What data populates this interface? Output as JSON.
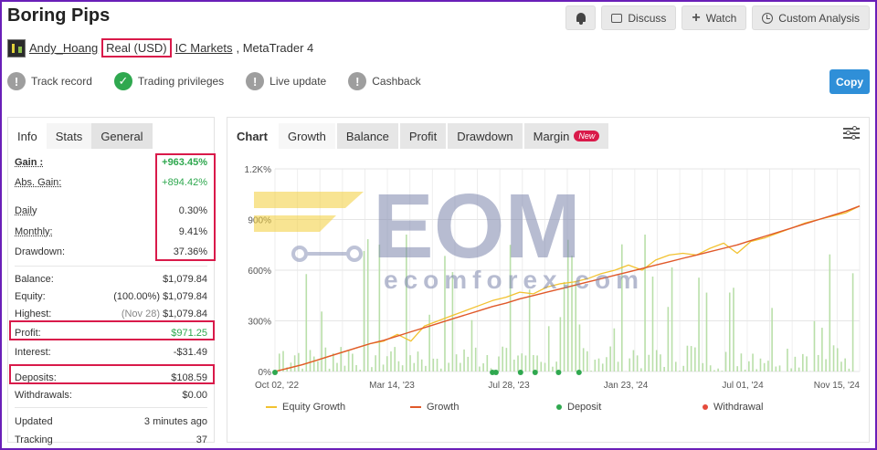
{
  "title": "Boring Pips",
  "header_actions": {
    "discuss": "Discuss",
    "watch": "Watch",
    "custom_analysis": "Custom Analysis"
  },
  "account": {
    "user": "Andy_Hoang",
    "account_type": "Real (USD)",
    "broker": "IC Markets",
    "platform": ", MetaTrader 4"
  },
  "badges": [
    {
      "label": "Track record",
      "icon": "exclamation-icon",
      "state": "gray"
    },
    {
      "label": "Trading privileges",
      "icon": "check-icon",
      "state": "green"
    },
    {
      "label": "Live update",
      "icon": "exclamation-icon",
      "state": "gray"
    },
    {
      "label": "Cashback",
      "icon": "exclamation-icon",
      "state": "gray"
    }
  ],
  "copy_label": "Copy",
  "left_tabs": [
    "Info",
    "Stats",
    "General"
  ],
  "stats": {
    "gain": {
      "label": "Gain :",
      "value": "+963.45%"
    },
    "abs_gain": {
      "label": "Abs. Gain:",
      "value": "+894.42%"
    },
    "daily": {
      "label": "Daily",
      "value": "0.30%"
    },
    "monthly": {
      "label": "Monthly:",
      "value": "9.41%"
    },
    "drawdown": {
      "label": "Drawdown:",
      "value": "37.36%"
    },
    "balance": {
      "label": "Balance:",
      "value": "$1,079.84"
    },
    "equity": {
      "label": "Equity:",
      "note": "(100.00%)",
      "value": "$1,079.84"
    },
    "highest": {
      "label": "Highest:",
      "note": "(Nov 28)",
      "value": "$1,079.84"
    },
    "profit": {
      "label": "Profit:",
      "value": "$971.25"
    },
    "interest": {
      "label": "Interest:",
      "value": "-$31.49"
    },
    "deposits": {
      "label": "Deposits:",
      "value": "$108.59"
    },
    "withdrawals": {
      "label": "Withdrawals:",
      "value": "$0.00"
    },
    "updated": {
      "label": "Updated",
      "value": "3 minutes ago"
    },
    "tracking": {
      "label": "Tracking",
      "value": "37"
    }
  },
  "chart_tabs": {
    "chart": "Chart",
    "growth": "Growth",
    "balance": "Balance",
    "profit": "Profit",
    "drawdown": "Drawdown",
    "margin": "Margin",
    "new_badge": "New"
  },
  "watermark": {
    "brand": "EOM",
    "site": "ecomforex.com"
  },
  "colors": {
    "growth": "#e0592a",
    "equity": "#f2c230",
    "bars": "#b9dfa9",
    "deposit": "#2fa84f",
    "withdrawal": "#e54b3c",
    "accent": "#2f8fd8",
    "highlight": "#d91a4a"
  },
  "chart_data": {
    "type": "line",
    "x_tick_labels": [
      "Oct 02, '22",
      "Mar 14, '23",
      "Jul 28, '23",
      "Jan 23, '24",
      "Jul 01, '24",
      "Nov 15, '24"
    ],
    "y_tick_labels": [
      "0%",
      "300%",
      "600%",
      "900%",
      "1.2K%"
    ],
    "ylim": [
      0,
      1200
    ],
    "series": [
      {
        "name": "Equity Growth",
        "values": [
          0,
          20,
          40,
          65,
          90,
          115,
          140,
          165,
          180,
          220,
          180,
          270,
          300,
          330,
          360,
          390,
          420,
          440,
          470,
          460,
          500,
          520,
          530,
          550,
          580,
          600,
          630,
          600,
          660,
          690,
          700,
          690,
          730,
          760,
          700,
          770,
          790,
          820,
          850,
          880,
          900,
          920,
          940,
          980
        ]
      },
      {
        "name": "Growth",
        "values": [
          0,
          20,
          40,
          65,
          90,
          115,
          140,
          165,
          185,
          210,
          235,
          260,
          285,
          310,
          335,
          360,
          385,
          405,
          430,
          450,
          470,
          490,
          510,
          530,
          550,
          570,
          590,
          610,
          630,
          650,
          670,
          690,
          710,
          730,
          750,
          775,
          800,
          825,
          850,
          875,
          900,
          925,
          950,
          980
        ]
      },
      {
        "name": "Deposit",
        "values": []
      },
      {
        "name": "Withdrawal",
        "values": []
      }
    ],
    "deposit_points": [
      0,
      0.372,
      0.378,
      0.42,
      0.445,
      0.485,
      0.52
    ],
    "legend": [
      "Equity Growth",
      "Growth",
      "Deposit",
      "Withdrawal"
    ],
    "grid": true
  }
}
